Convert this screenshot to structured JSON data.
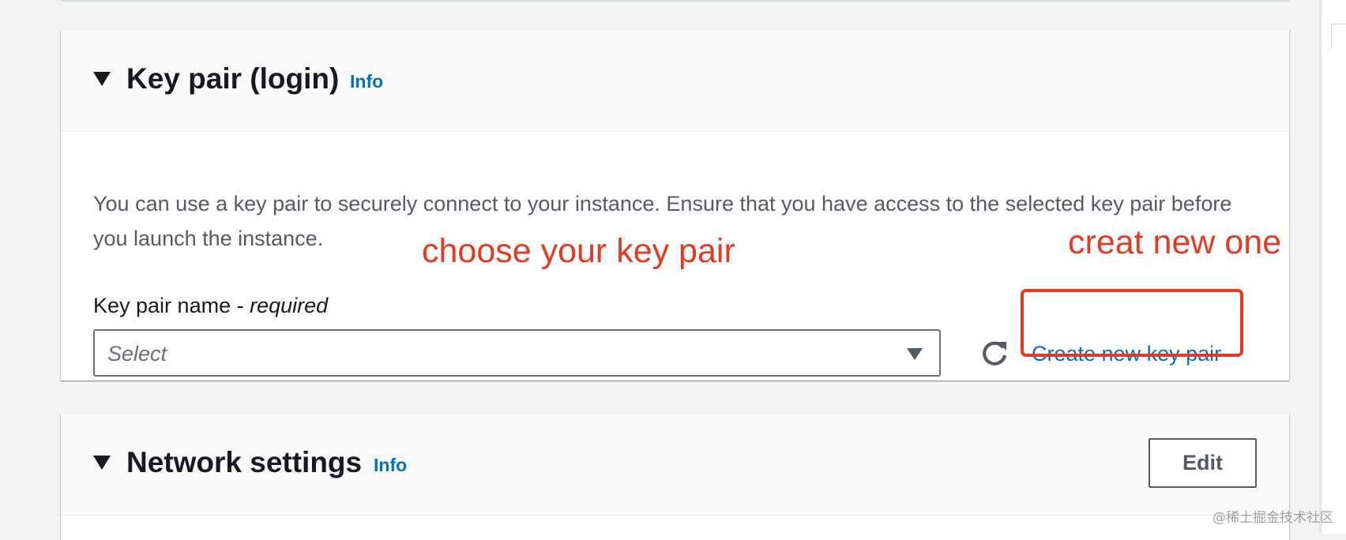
{
  "key_pair_section": {
    "title": "Key pair (login)",
    "info_link": "Info",
    "description": "You can use a key pair to securely connect to your instance. Ensure that you have access to the selected key pair before you launch the instance.",
    "field_label": "Key pair name - ",
    "field_label_required": "required",
    "select_placeholder": "Select",
    "create_link": "Create new key pair"
  },
  "network_section": {
    "title": "Network settings",
    "info_link": "Info",
    "edit_button": "Edit"
  },
  "annotations": {
    "choose": "choose your key pair",
    "create": "creat new one",
    "color": "#e53a22"
  },
  "watermark": "@稀土掘金技术社区",
  "icons": {
    "expand": "caret-down-icon",
    "refresh": "refresh-icon",
    "dropdown": "chevron-down-icon"
  },
  "colors": {
    "link": "#0073bb",
    "text": "#16191f",
    "secondary_text": "#545b64",
    "page_background": "#f2f3f3"
  }
}
